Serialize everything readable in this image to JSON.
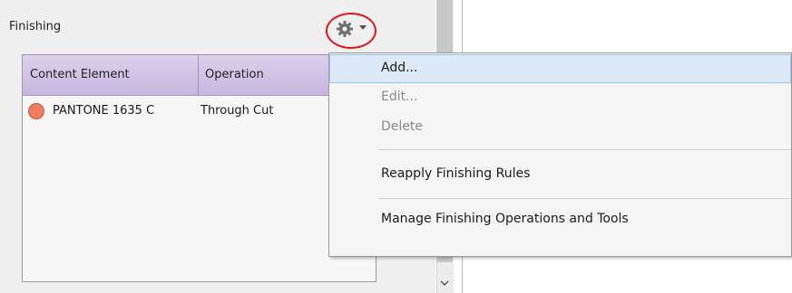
{
  "panel": {
    "title": "Finishing"
  },
  "table": {
    "columns": [
      "Content Element",
      "Operation"
    ],
    "rows": [
      {
        "element": "PANTONE 1635 C",
        "operation": "Through Cut",
        "swatch_color": "#ef7d5f"
      }
    ]
  },
  "menu": {
    "items": [
      {
        "label": "Add...",
        "enabled": true,
        "highlighted": true
      },
      {
        "label": "Edit...",
        "enabled": false
      },
      {
        "label": "Delete",
        "enabled": false
      },
      {
        "label": "Reapply Finishing Rules",
        "enabled": true
      },
      {
        "label": "Manage Finishing Operations and Tools",
        "enabled": true
      }
    ]
  },
  "icons": {
    "settings": "gear-icon",
    "dropdown": "chevron-down-icon",
    "scroll_down": "scroll-down-icon"
  },
  "colors": {
    "highlight_ring": "#e01515",
    "header_gradient": "#c8b6de",
    "menu_highlight": "#dde9f7"
  }
}
